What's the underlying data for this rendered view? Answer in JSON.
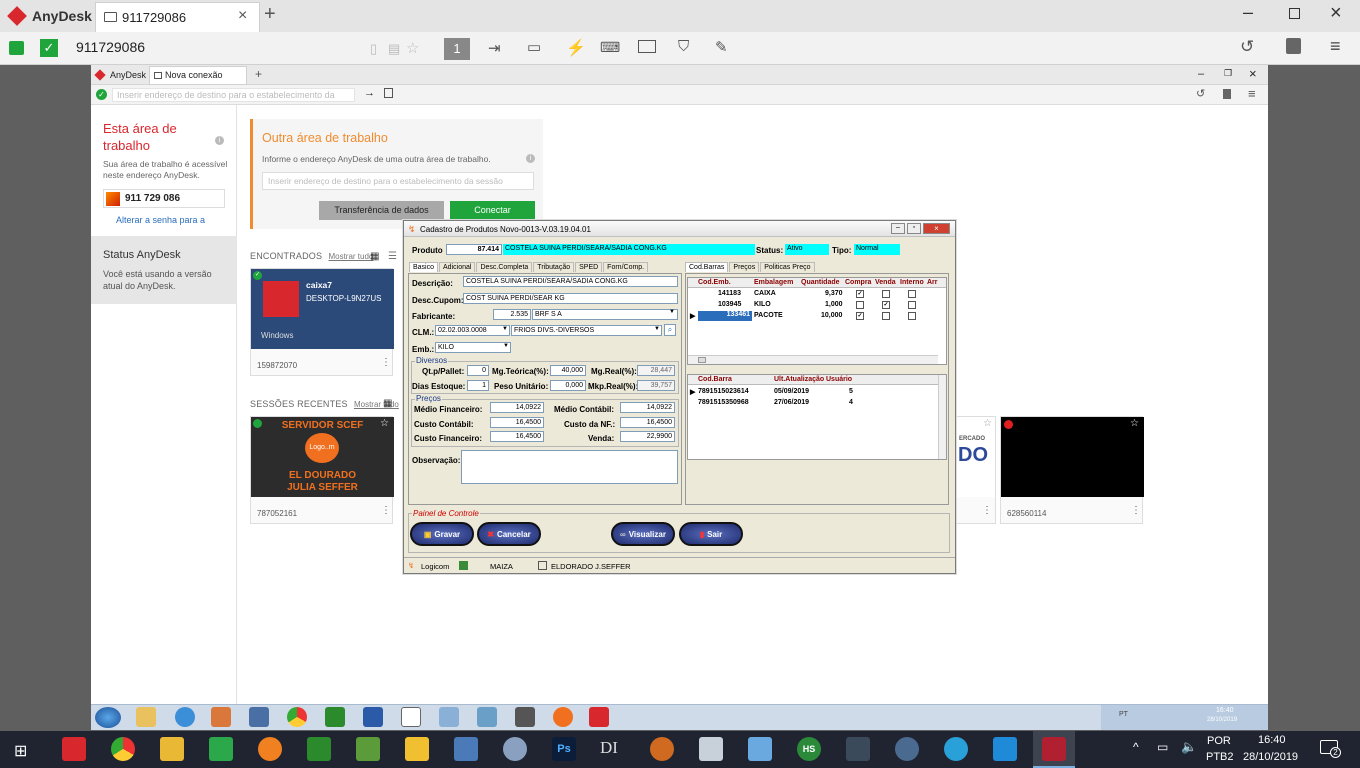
{
  "outer": {
    "app_name": "AnyDesk",
    "tab_title": "911729086",
    "address_value": "911729086",
    "page_indicator": "1",
    "colors": {
      "brand": "#d8282e",
      "accent_green": "#1fa53c"
    }
  },
  "inner": {
    "tab_app": "AnyDesk",
    "tab_title": "Nova conexão",
    "address_placeholder": "Inserir endereço de destino para o estabelecimento da",
    "this_area": {
      "title": "Esta área de trabalho",
      "desc": "Sua área de trabalho é acessível neste endereço AnyDesk.",
      "address": "911 729 086",
      "change_password_link": "Alterar a senha para a"
    },
    "status": {
      "title": "Status AnyDesk",
      "desc": "Você está usando a versão atual do AnyDesk."
    },
    "other_area": {
      "title": "Outra área de trabalho",
      "desc": "Informe o endereço AnyDesk de uma outra área de trabalho.",
      "placeholder": "Inserir endereço de destino para o estabelecimento da sessão",
      "transfer_button": "Transferência de dados",
      "connect_button": "Conectar"
    },
    "found": {
      "label": "ENCONTRADOS",
      "show_all": "Mostrar tudo",
      "card": {
        "name": "caixa7",
        "host": "DESKTOP-L9N27US",
        "os": "Windows",
        "id": "159872070"
      }
    },
    "recent": {
      "label": "SESSÕES RECENTES",
      "show_all": "Mostrar tudo",
      "cards": [
        {
          "id": "787052161",
          "title": "SERVIDOR SCEF",
          "sub1": "EL DOURADO",
          "sub2": "JULIA SEFFER",
          "logo": "Logo..m"
        },
        {
          "id": "",
          "title": "ERCADO",
          "sub1": "DO"
        },
        {
          "id": "628560114"
        }
      ]
    }
  },
  "form": {
    "title": "Cadastro de Produtos Novo-0013-V.03.19.04.01",
    "produto_label": "Produto",
    "produto_code": "87.414",
    "produto_name": "COSTELA SUINA PERDI/SEARA/SADIA CONG.KG",
    "status_label": "Status:",
    "status_value": "Ativo",
    "tipo_label": "Tipo:",
    "tipo_value": "Normal",
    "left_tabs": [
      "Basico",
      "Adicional",
      "Desc.Completa",
      "Tributação",
      "SPED",
      "Forn/Comp."
    ],
    "right_tabs": [
      "Cod.Barras",
      "Preços",
      "Politicas Preço"
    ],
    "descricao_label": "Descrição:",
    "descricao": "COSTELA SUINA PERDI/SEARA/SADIA CONG.KG",
    "cupom_label": "Desc.Cupom:",
    "cupom": "COST SUINA PERDI/SEAR KG",
    "fabricante_label": "Fabricante:",
    "fabricante_code": "2.535",
    "fabricante_name": "BRF S A",
    "clm_label": "CLM.:",
    "clm_code": "02.02.003.0008",
    "clm_name": "FRIOS DIVS.-DIVERSOS",
    "emb_label": "Emb.:",
    "emb": "KILO",
    "diversos_label": "Diversos",
    "qt_pallet_label": "Qt.p/Pallet:",
    "qt_pallet": "0",
    "mg_teorica_label": "Mg.Teórica(%):",
    "mg_teorica": "40,000",
    "mg_real_label": "Mg.Real(%):",
    "mg_real": "28,447",
    "dias_estoque_label": "Dias Estoque:",
    "dias_estoque": "1",
    "peso_unit_label": "Peso Unitário:",
    "peso_unit": "0,000",
    "mkp_real_label": "Mkp.Real(%):",
    "mkp_real": "39,757",
    "precos_label": "Preços",
    "medio_fin_label": "Médio Financeiro:",
    "medio_fin": "14,0922",
    "medio_cont_label": "Médio Contábil:",
    "medio_cont": "14,0922",
    "custo_cont_label": "Custo Contábil:",
    "custo_cont": "16,4500",
    "custo_nf_label": "Custo da NF.:",
    "custo_nf": "16,4500",
    "custo_fin_label": "Custo Financeiro:",
    "custo_fin": "16,4500",
    "venda_label": "Venda:",
    "venda": "22,9900",
    "obs_label": "Observação:",
    "emb_grid": {
      "headers": [
        "Cod.Emb.",
        "Embalagem",
        "Quantidade",
        "Compra",
        "Venda",
        "Interno",
        "Arr"
      ],
      "rows": [
        {
          "cod": "141183",
          "emb": "CAIXA",
          "qtd": "9,370",
          "compra": true,
          "venda": false,
          "interno": false
        },
        {
          "cod": "103945",
          "emb": "KILO",
          "qtd": "1,000",
          "compra": false,
          "venda": true,
          "interno": false
        },
        {
          "cod": "133461",
          "emb": "PACOTE",
          "qtd": "10,000",
          "compra": true,
          "venda": false,
          "interno": false
        }
      ]
    },
    "barcode_grid": {
      "headers": [
        "Cod.Barra",
        "Ult.Atualização",
        "Usuário"
      ],
      "rows": [
        {
          "barra": "7891515023614",
          "data": "05/09/2019",
          "usuario": "5"
        },
        {
          "barra": "7891515350968",
          "data": "27/06/2019",
          "usuario": "4"
        }
      ]
    },
    "painel_label": "Painel de Controle",
    "buttons": {
      "gravar": "Gravar",
      "cancelar": "Cancelar",
      "visualizar": "Visualizar",
      "sair": "Sair"
    },
    "status_bar": {
      "company": "Logicom",
      "user": "MAIZA",
      "store": "ELDORADO J.SEFFER"
    }
  },
  "remote_tray": {
    "lang": "PT",
    "time": "16:40",
    "date": "28/10/2019"
  },
  "win_tray": {
    "lang1": "POR",
    "lang2": "PTB2",
    "time": "16:40",
    "date": "28/10/2019",
    "notifications": "2"
  }
}
